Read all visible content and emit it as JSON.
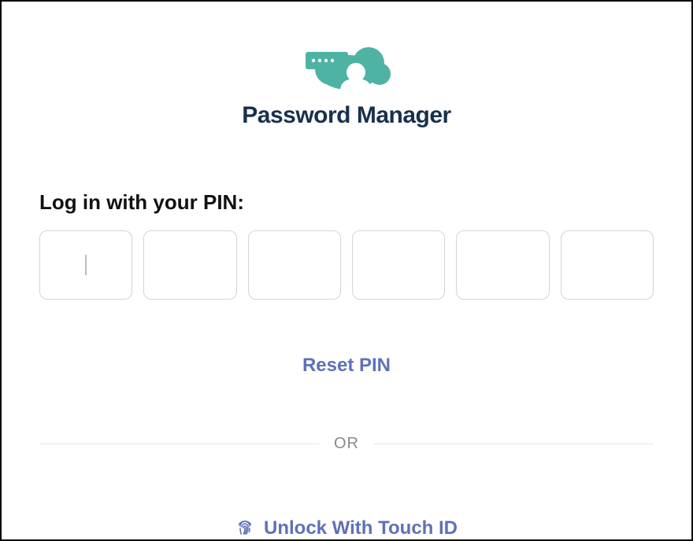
{
  "app": {
    "title": "Password Manager"
  },
  "login": {
    "prompt": "Log in with your PIN:",
    "pin_length": 6,
    "pin_values": [
      "",
      "",
      "",
      "",
      "",
      ""
    ],
    "focused_index": 0
  },
  "actions": {
    "reset_pin_label": "Reset PIN",
    "touch_id_label": "Unlock With Touch ID"
  },
  "divider": {
    "label": "OR"
  },
  "colors": {
    "brand_teal": "#4eb3a3",
    "title_navy": "#18304d",
    "link_blue": "#5e71b8",
    "border_gray": "#d4d4d8",
    "divider_gray": "#e5e5e5",
    "muted_gray": "#8a8a8a"
  },
  "icons": {
    "logo": "password-manager-logo",
    "fingerprint": "fingerprint-icon"
  }
}
